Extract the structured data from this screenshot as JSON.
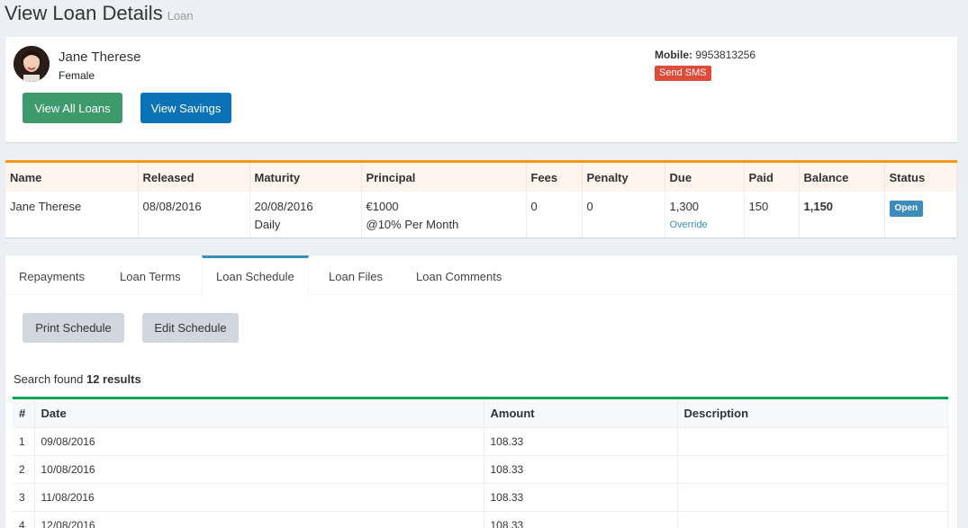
{
  "page": {
    "title": "View Loan Details",
    "subtitle": "Loan"
  },
  "client": {
    "name": "Jane Therese",
    "gender": "Female",
    "mobile_label": "Mobile:",
    "mobile": "9953813256",
    "send_sms": "Send SMS",
    "view_all_loans": "View All Loans",
    "view_savings": "View Savings"
  },
  "loan": {
    "headers": [
      "Name",
      "Released",
      "Maturity",
      "Principal",
      "Fees",
      "Penalty",
      "Due",
      "Paid",
      "Balance",
      "Status"
    ],
    "name": "Jane Therese",
    "released": "08/08/2016",
    "maturity": "20/08/2016",
    "frequency": "Daily",
    "principal": "€1000",
    "interest": "@10% Per Month",
    "fees": "0",
    "penalty": "0",
    "due": "1,300",
    "override": "Override",
    "paid": "150",
    "balance": "1,150",
    "status": "Open"
  },
  "tabs": [
    "Repayments",
    "Loan Terms",
    "Loan Schedule",
    "Loan Files",
    "Loan Comments"
  ],
  "active_tab": "Loan Schedule",
  "schedule": {
    "print": "Print Schedule",
    "edit": "Edit Schedule",
    "search_prefix": "Search found",
    "search_count": "12 results",
    "headers": [
      "#",
      "Date",
      "Amount",
      "Description"
    ],
    "rows": [
      [
        "1",
        "09/08/2016",
        "108.33",
        ""
      ],
      [
        "2",
        "10/08/2016",
        "108.33",
        ""
      ],
      [
        "3",
        "11/08/2016",
        "108.33",
        ""
      ],
      [
        "4",
        "12/08/2016",
        "108.33",
        ""
      ]
    ]
  },
  "colors": {
    "accent_orange": "#f39c12",
    "accent_green": "#00a65a",
    "accent_blue": "#3c8dbc",
    "danger": "#dd4b39"
  }
}
